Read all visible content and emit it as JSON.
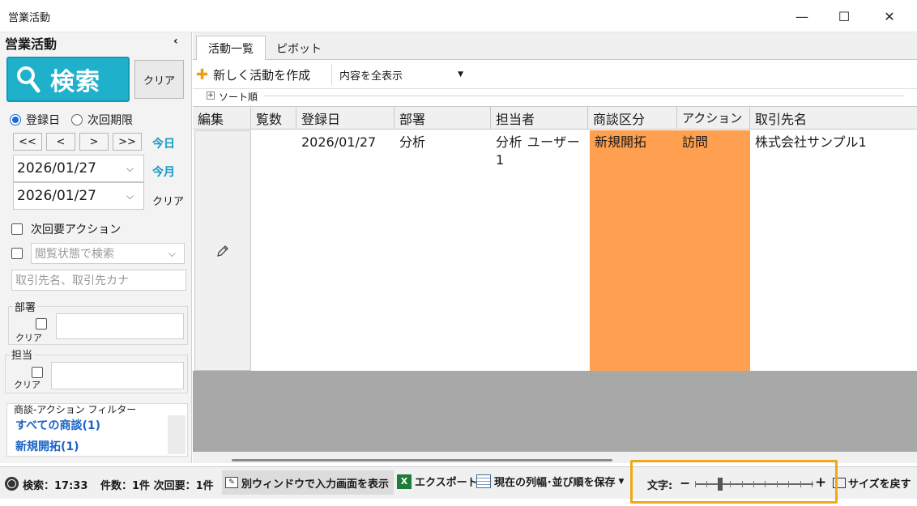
{
  "window": {
    "title": "営業活動",
    "minimize": "—",
    "maximize": "☐",
    "close": "✕"
  },
  "sidebar": {
    "title": "営業活動",
    "collapse_icon": "‹",
    "search_button": "検索",
    "clear_button": "クリア",
    "date_mode": {
      "registered": "登録日",
      "next_deadline": "次回期限",
      "selected": "registered"
    },
    "nav_buttons": [
      "<<",
      "<",
      ">",
      ">>"
    ],
    "today_link": "今日",
    "month_link": "今月",
    "clear_link": "クリア",
    "date_from": "2026/01/27",
    "date_to": "2026/01/27",
    "next_action_label": "次回要アクション",
    "view_status_placeholder": "閲覧状態で検索",
    "client_placeholder": "取引先名、取引先カナ",
    "department_group": {
      "label": "部署",
      "clear": "クリア"
    },
    "owner_group": {
      "label": "担当",
      "clear": "クリア"
    },
    "filter_group": {
      "label": "商談-アクション フィルター",
      "items": [
        "すべての商談(1)",
        "新規開拓(1)"
      ]
    }
  },
  "tabs": {
    "list": "活動一覧",
    "pivot": "ピボット"
  },
  "toolbar": {
    "new_activity": "新しく活動を作成",
    "display_select": "内容を全表示"
  },
  "sort_label": "ソート順",
  "grid": {
    "columns": [
      "編集",
      "覧数",
      "登録日",
      "部署",
      "担当者",
      "商談区分",
      "アクション",
      "取引先名"
    ],
    "rows": [
      {
        "views": "",
        "date": "2026/01/27",
        "department": "分析",
        "owner": "分析 ユーザー1",
        "deal_type": "新規開拓",
        "action": "訪問",
        "client": "株式会社サンプル1"
      }
    ],
    "highlight_color": "#ffa050"
  },
  "status": {
    "search_time": "検索：17:33",
    "count": "件数：1件 次回要：1件",
    "open_window": "別ウィンドウで入力画面を表示",
    "export": "エクスポート",
    "save_layout": "現在の列幅･並び順を保存",
    "font_label": "文字:",
    "font_minus": "−",
    "font_plus": "+",
    "reset_size": "サイズを戻す",
    "font_zoom_fraction": 0.2
  },
  "colors": {
    "accent": "#1fb0cc",
    "link": "#1a63c7",
    "highlight": "#f0a818"
  }
}
